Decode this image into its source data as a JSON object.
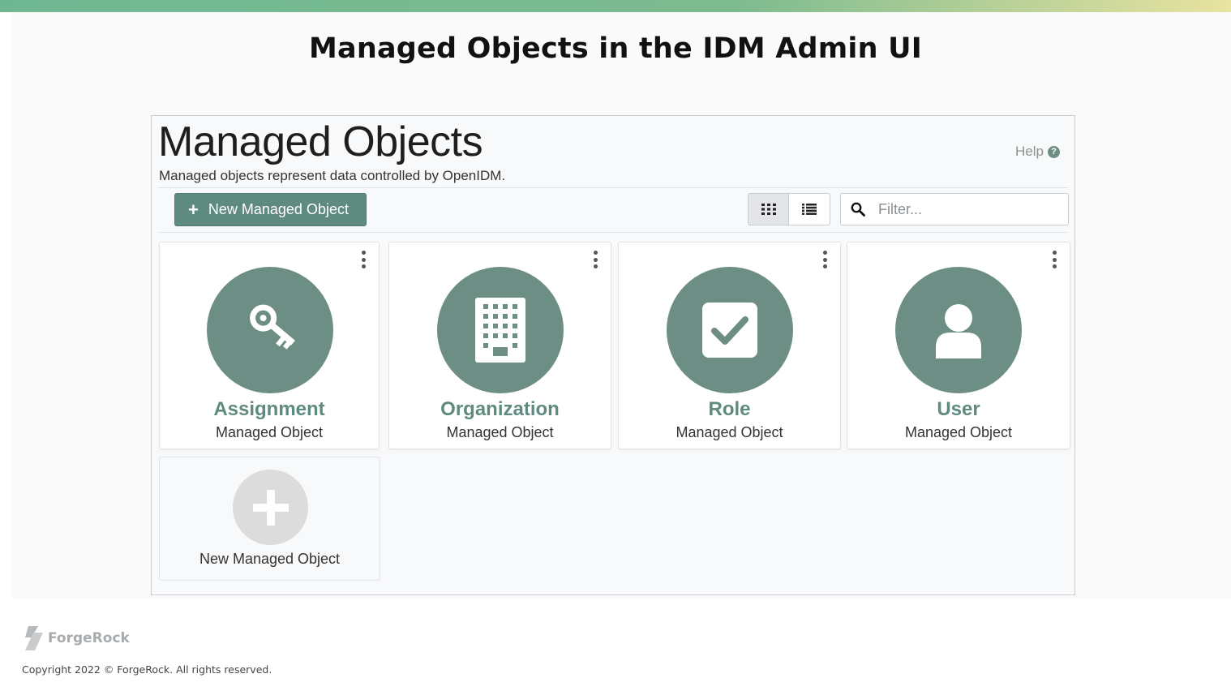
{
  "slide": {
    "title": "Managed Objects in the IDM Admin UI",
    "accent_gradient": [
      "#6fb793",
      "#e9e3a0"
    ]
  },
  "panel": {
    "title": "Managed Objects",
    "description": "Managed objects represent data controlled by OpenIDM.",
    "help_label": "Help",
    "help_icon": "question-circle-icon"
  },
  "toolbar": {
    "new_button_label": "New Managed Object",
    "new_button_icon": "plus-icon",
    "views": [
      {
        "name": "grid-view",
        "icon": "grid-icon",
        "active": true
      },
      {
        "name": "list-view",
        "icon": "list-icon",
        "active": false
      }
    ],
    "filter_placeholder": "Filter...",
    "filter_value": "",
    "filter_icon": "search-icon"
  },
  "cards": [
    {
      "name": "Assignment",
      "subtitle": "Managed Object",
      "icon": "key-icon"
    },
    {
      "name": "Organization",
      "subtitle": "Managed Object",
      "icon": "building-icon"
    },
    {
      "name": "Role",
      "subtitle": "Managed Object",
      "icon": "check-square-icon"
    },
    {
      "name": "User",
      "subtitle": "Managed Object",
      "icon": "user-icon"
    }
  ],
  "add_card": {
    "label": "New Managed Object",
    "icon": "plus-icon"
  },
  "colors": {
    "primary": "#5f8a7f",
    "icon_circle": "#6d8e85"
  },
  "footer": {
    "brand": "ForgeRock",
    "copyright": "Copyright 2022 © ForgeRock.  All rights reserved."
  }
}
